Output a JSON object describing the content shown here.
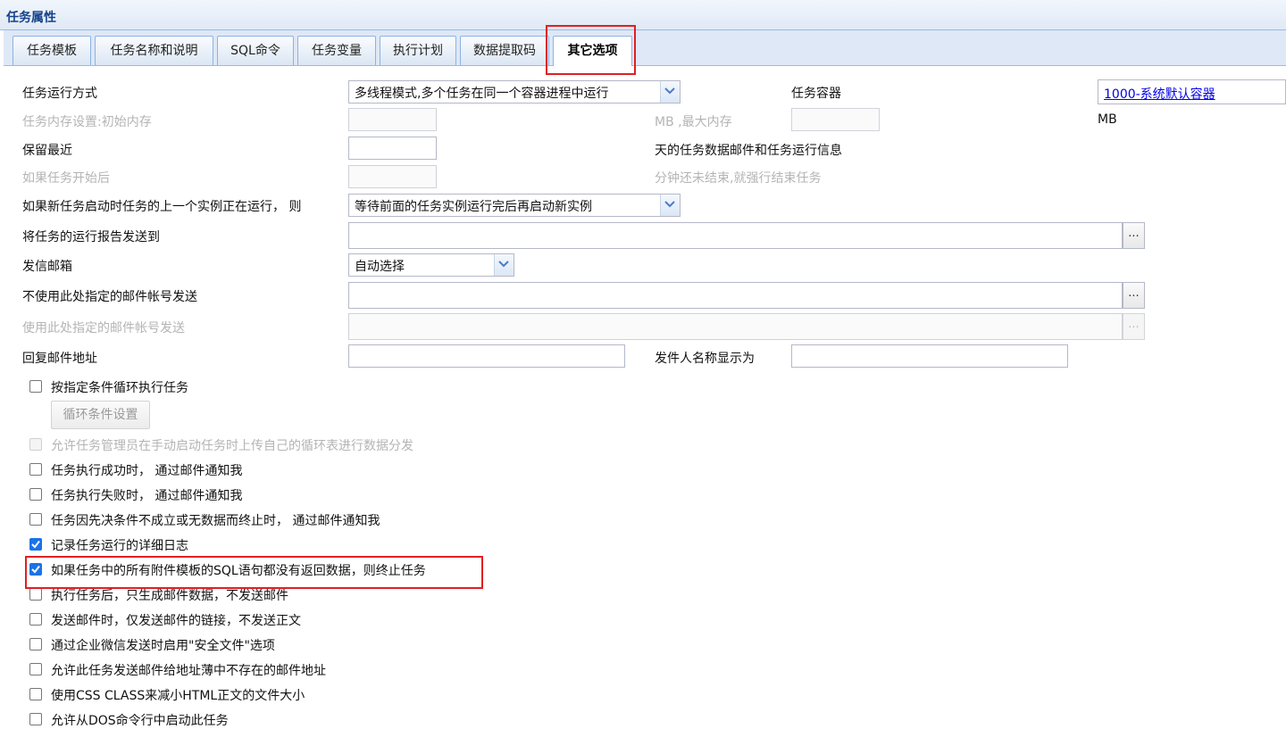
{
  "panel": {
    "title": "任务属性"
  },
  "tabs": [
    "任务模板",
    "任务名称和说明",
    "SQL命令",
    "任务变量",
    "执行计划",
    "数据提取码",
    "其它选项"
  ],
  "active_tab": "其它选项",
  "form": {
    "run_mode_label": "任务运行方式",
    "run_mode_value": "多线程模式,多个任务在同一个容器进程中运行",
    "container_label": "任务容器",
    "container_value": "1000-系统默认容器",
    "memory_init_label": "任务内存设置:初始内存",
    "memory_max_label": "MB ,最大内存",
    "memory_unit": "MB",
    "keep_recent_label": "保留最近",
    "keep_recent_suffix": "天的任务数据邮件和任务运行信息",
    "timeout_label": "如果任务开始后",
    "timeout_suffix": "分钟还未结束,就强行结束任务",
    "overlap_label": "如果新任务启动时任务的上一个实例正在运行， 则",
    "overlap_value": "等待前面的任务实例运行完后再启动新实例",
    "report_to_label": "将任务的运行报告发送到",
    "sender_mailbox_label": "发信邮箱",
    "sender_mailbox_value": "自动选择",
    "exclude_accounts_label": "不使用此处指定的邮件帐号发送",
    "use_accounts_label": "使用此处指定的邮件帐号发送",
    "reply_to_label": "回复邮件地址",
    "sender_name_label": "发件人名称显示为",
    "ellipsis": "..."
  },
  "loop_button": "循环条件设置",
  "options": [
    {
      "label": "按指定条件循环执行任务",
      "checked": false,
      "disabled": false
    },
    {
      "label": "允许任务管理员在手动启动任务时上传自己的循环表进行数据分发",
      "checked": false,
      "disabled": true
    },
    {
      "label": "任务执行成功时， 通过邮件通知我",
      "checked": false,
      "disabled": false
    },
    {
      "label": "任务执行失败时， 通过邮件通知我",
      "checked": false,
      "disabled": false
    },
    {
      "label": "任务因先决条件不成立或无数据而终止时， 通过邮件通知我",
      "checked": false,
      "disabled": false
    },
    {
      "label": "记录任务运行的详细日志",
      "checked": true,
      "disabled": false
    },
    {
      "label": "如果任务中的所有附件模板的SQL语句都没有返回数据，则终止任务",
      "checked": true,
      "disabled": false
    },
    {
      "label": "执行任务后，只生成邮件数据，不发送邮件",
      "checked": false,
      "disabled": false
    },
    {
      "label": "发送邮件时，仅发送邮件的链接，不发送正文",
      "checked": false,
      "disabled": false
    },
    {
      "label": "通过企业微信发送时启用\"安全文件\"选项",
      "checked": false,
      "disabled": false
    },
    {
      "label": "允许此任务发送邮件给地址薄中不存在的邮件地址",
      "checked": false,
      "disabled": false
    },
    {
      "label": "使用CSS CLASS来减小HTML正文的文件大小",
      "checked": false,
      "disabled": false
    },
    {
      "label": "允许从DOS命令行中启动此任务",
      "checked": false,
      "disabled": false
    }
  ],
  "colors": {
    "highlight": "#e02020",
    "accent": "#1a73e8",
    "header_text": "#15428b"
  }
}
